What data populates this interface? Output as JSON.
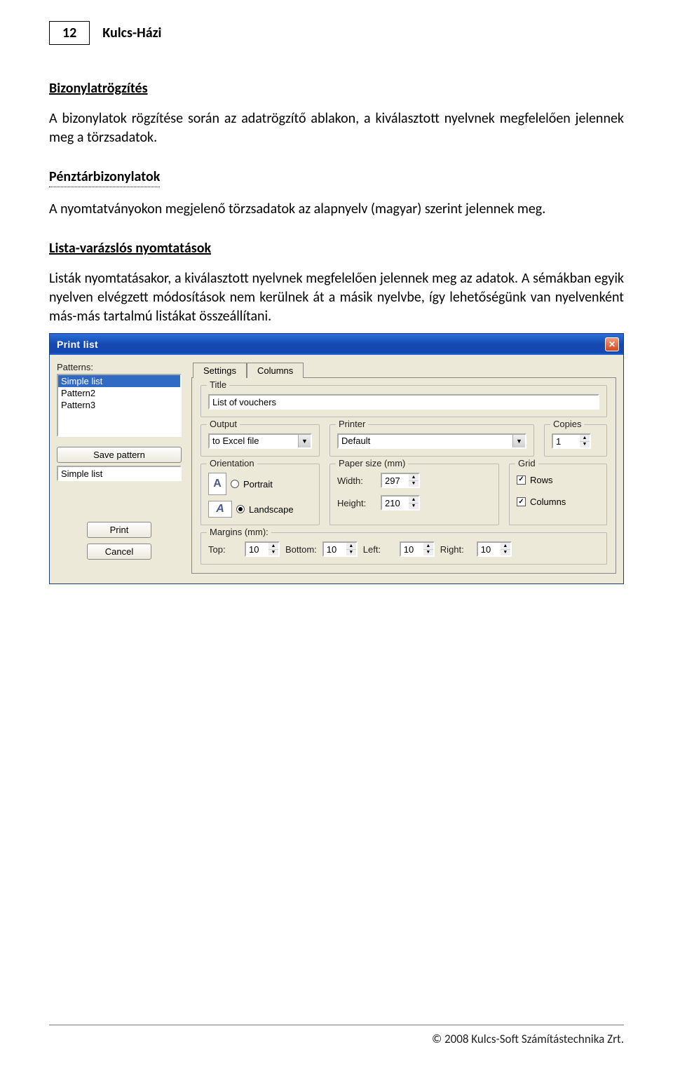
{
  "page_number": "12",
  "doc_title": "Kulcs-Házi",
  "section1_heading": "Bizonylatrögzítés",
  "section1_para": "A bizonylatok rögzítése során az adatrögzítő ablakon, a kiválasztott nyelvnek megfelelően jelennek meg a törzsadatok.",
  "section2_heading": "Pénztárbizonylatok",
  "section2_para": "A nyomtatványokon megjelenő törzsadatok az alapnyelv (magyar) szerint jelennek meg.",
  "section3_heading": "Lista-varázslós nyomtatások",
  "section3_para": "Listák nyomtatásakor, a kiválasztott nyelvnek megfelelően jelennek meg az adatok. A sémákban egyik nyelven elvégzett módosítások nem kerülnek át a másik nyelvbe, így lehetőségünk van nyelvenként más-más tartalmú listákat összeállítani.",
  "footer_text": "© 2008 Kulcs-Soft Számítástechnika Zrt.",
  "dialog": {
    "title": "Print list",
    "close": "✕",
    "patterns_label": "Patterns:",
    "patterns": [
      "Simple list",
      "Pattern2",
      "Pattern3"
    ],
    "save_pattern": "Save pattern",
    "pattern_name": "Simple list",
    "print_btn": "Print",
    "cancel_btn": "Cancel",
    "tabs": {
      "settings": "Settings",
      "columns": "Columns"
    },
    "title_group": "Title",
    "title_value": "List of vouchers",
    "output_group": "Output",
    "output_value": "to Excel file",
    "printer_group": "Printer",
    "printer_value": "Default",
    "copies_group": "Copies",
    "copies_value": "1",
    "orientation_group": "Orientation",
    "orientation_portrait": "Portrait",
    "orientation_landscape": "Landscape",
    "paper_group": "Paper size (mm)",
    "paper_width_label": "Width:",
    "paper_width_value": "297",
    "paper_height_label": "Height:",
    "paper_height_value": "210",
    "grid_group": "Grid",
    "grid_rows": "Rows",
    "grid_columns": "Columns",
    "margins_group": "Margins (mm):",
    "margin_top_label": "Top:",
    "margin_top": "10",
    "margin_bottom_label": "Bottom:",
    "margin_bottom": "10",
    "margin_left_label": "Left:",
    "margin_left": "10",
    "margin_right_label": "Right:",
    "margin_right": "10"
  }
}
